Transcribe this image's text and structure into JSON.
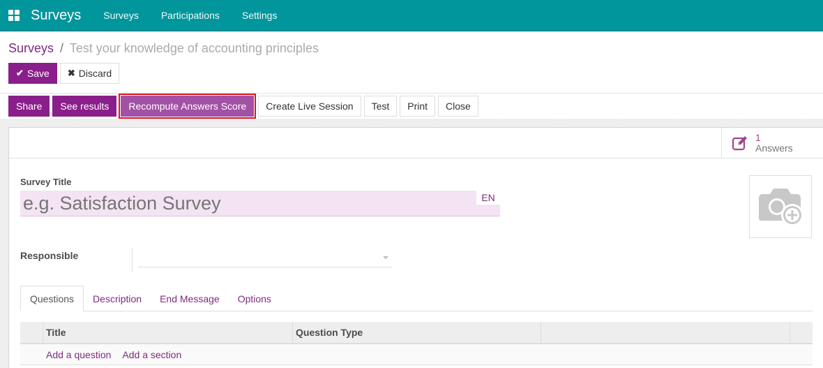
{
  "navbar": {
    "app_name": "Surveys",
    "menu": [
      "Surveys",
      "Participations",
      "Settings"
    ],
    "color": "#00969c"
  },
  "breadcrumb": {
    "parent": "Surveys",
    "separator": "/",
    "current": "Test your knowledge of accounting principles"
  },
  "edit_buttons": {
    "save": "Save",
    "discard": "Discard"
  },
  "header_buttons": {
    "share": "Share",
    "see_results": "See results",
    "recompute": "Recompute Answers Score",
    "create_live_session": "Create Live Session",
    "test": "Test",
    "print": "Print",
    "close": "Close"
  },
  "stat_button": {
    "value": "1",
    "label": "Answers"
  },
  "form": {
    "title_label": "Survey Title",
    "title_placeholder": "e.g. Satisfaction Survey",
    "title_value": "",
    "lang": "EN",
    "responsible_label": "Responsible",
    "responsible_value": ""
  },
  "tabs": [
    {
      "label": "Questions",
      "active": true
    },
    {
      "label": "Description",
      "active": false
    },
    {
      "label": "End Message",
      "active": false
    },
    {
      "label": "Options",
      "active": false
    }
  ],
  "questions_table": {
    "columns": [
      "Title",
      "Question Type",
      ""
    ],
    "rows": [],
    "add_question": "Add a question",
    "add_section": "Add a section"
  },
  "colors": {
    "primary": "#8a1e8a",
    "highlight_outline": "#e0141e",
    "link": "#7c2b7e"
  }
}
